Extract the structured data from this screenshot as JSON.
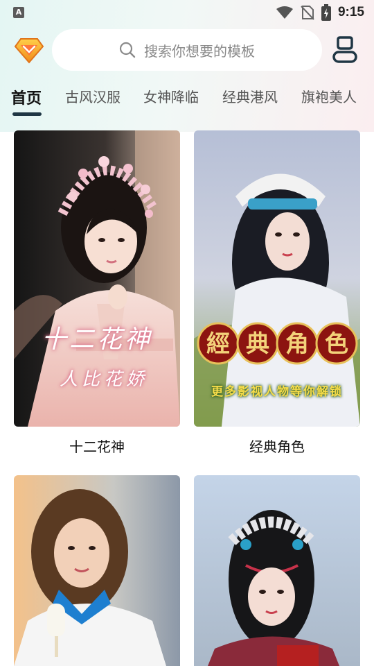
{
  "status_bar": {
    "left_indicator": "A",
    "time": "9:15",
    "icons": [
      "wifi-icon",
      "no-sim-icon",
      "battery-charging-icon"
    ]
  },
  "header": {
    "vip_icon": "diamond-badge-icon",
    "search_icon": "search-icon",
    "search_placeholder": "搜索你想要的模板",
    "user_icon": "user-profile-icon"
  },
  "tabs": [
    {
      "label": "首页",
      "active": true
    },
    {
      "label": "古风汉服",
      "active": false
    },
    {
      "label": "女神降临",
      "active": false
    },
    {
      "label": "经典港风",
      "active": false
    },
    {
      "label": "旗袍美人",
      "active": false
    }
  ],
  "templates": [
    {
      "title": "十二花神",
      "overlay_line1": "十二花神",
      "overlay_line2": "人比花娇"
    },
    {
      "title": "经典角色",
      "overlay_chars": [
        "經",
        "典",
        "角",
        "色"
      ],
      "overlay_subtitle": "更多影视人物等你解锁"
    },
    {
      "title": ""
    },
    {
      "title": ""
    }
  ],
  "colors": {
    "accent_dark": "#1f3644",
    "badge_orange": "#f2a01e",
    "seal_red": "#8c1410",
    "seal_gold": "#e8c15a"
  }
}
